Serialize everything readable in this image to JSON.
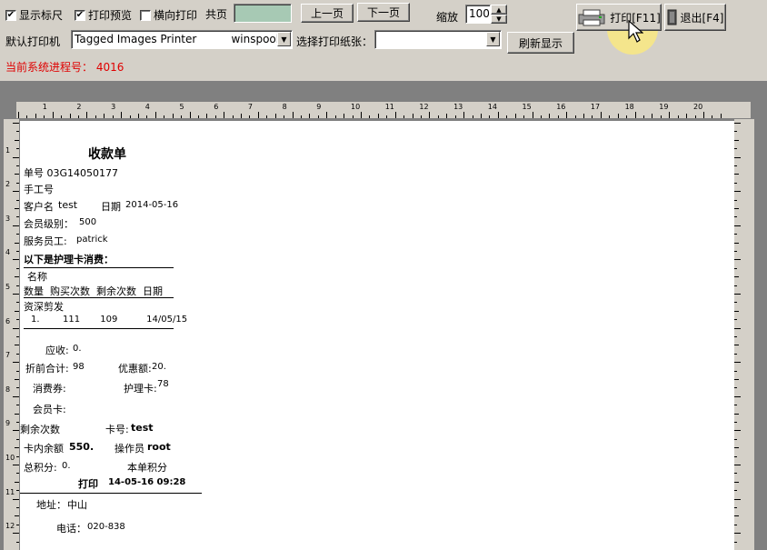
{
  "toolbar": {
    "show_ruler_label": "显示标尺",
    "print_preview_label": "打印预览",
    "landscape_label": "横向打印",
    "show_ruler_checked": true,
    "print_preview_checked": true,
    "landscape_checked": false,
    "total_pages_label": "共页",
    "prev_page_label": "上一页",
    "next_page_label": "下一页",
    "zoom_label": "缩放",
    "zoom_value": "100",
    "print_label": "打印[F11]",
    "exit_label": "退出[F4]",
    "default_printer_label": "默认打印机",
    "printer_value": "Tagged Images Printer          winspool  I",
    "paper_label": "选择打印纸张：",
    "paper_value": "",
    "refresh_label": "刷新显示",
    "process_label": "当前系统进程号：",
    "process_value": "4016"
  },
  "ruler": {
    "top_numbers": [
      "1",
      "2",
      "3",
      "4",
      "5",
      "6",
      "7",
      "8",
      "9",
      "10",
      "11",
      "12",
      "13",
      "14",
      "15",
      "16",
      "17",
      "18",
      "19",
      "20"
    ],
    "left_numbers": [
      "1",
      "2",
      "3",
      "4",
      "5",
      "6",
      "7",
      "8",
      "9",
      "10",
      "11",
      "12"
    ]
  },
  "receipt": {
    "title": "收款单",
    "order_no": "单号 03G14050177",
    "manual_no": "手工号",
    "customer_label": "客户名",
    "customer_value": "test",
    "date_label": "日期",
    "date_value": "2014-05-16",
    "member_level_label": "会员级别：",
    "member_level_value": "500",
    "staff_label": "服务员工:",
    "staff_value": "patrick",
    "section_title": "以下是护理卡消费：",
    "col_name": "名称",
    "col_headers": "数量  购买次数  剩余次数  日期",
    "item_name": "资深剪发",
    "item_row": "1.        111       109          14/05/15",
    "receivable_label": "应收:",
    "receivable_value": "0.",
    "pre_discount_label": "折前合计:",
    "pre_discount_value": "98",
    "discount_label": "优惠额:",
    "discount_value": "20.",
    "voucher_label": "消费券:",
    "care_card_label": "护理卡:",
    "care_card_value": "78",
    "member_card_label": "会员卡:",
    "remaining_label": "剩余次数",
    "card_no_label": "卡号:",
    "card_no_value": "test",
    "card_balance_label": "卡内余额",
    "card_balance_value": "550.",
    "operator_label": "操作员",
    "operator_value": "root",
    "total_points_label": "总积分:",
    "total_points_value": "0.",
    "this_points_label": "本单积分",
    "print_label": "打印",
    "print_time": "14-05-16 09:28",
    "address_label": "地址：",
    "address_value": "中山",
    "phone_label": "电话：",
    "phone_value": "020-838"
  },
  "colors": {
    "process_text": "#e00000",
    "window_bg": "#d4d0c8",
    "page_edit_bg": "#a7c9b4",
    "dark_area": "#808080"
  }
}
